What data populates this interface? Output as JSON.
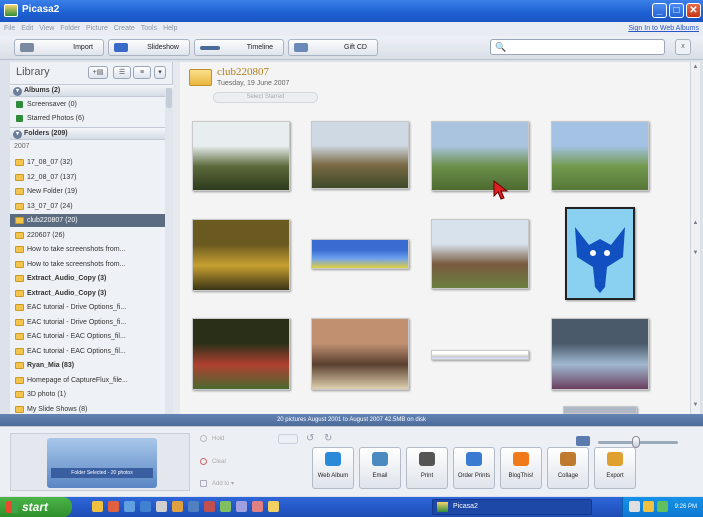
{
  "window": {
    "title": "Picasa2"
  },
  "menu": {
    "items": [
      "File",
      "Edit",
      "View",
      "Folder",
      "Picture",
      "Create",
      "Tools",
      "Help"
    ],
    "sign_in": "Sign In to Web Albums"
  },
  "toolbar": {
    "import": "Import",
    "slideshow": "Slideshow",
    "timeline": "Timeline",
    "gift_cd": "Gift CD"
  },
  "search": {
    "placeholder": "",
    "clear_label": "x"
  },
  "library": {
    "label": "Library",
    "albums_header": "Albums (2)",
    "albums": [
      "Screensaver (0)",
      "Starred Photos (6)"
    ],
    "folders_header": "Folders (209)",
    "year": "2007",
    "folders": [
      {
        "label": "17_08_07 (32)",
        "bold": false,
        "selected": false
      },
      {
        "label": "12_08_07 (137)",
        "bold": false,
        "selected": false
      },
      {
        "label": "New Folder (19)",
        "bold": false,
        "selected": false
      },
      {
        "label": "13_07_07 (24)",
        "bold": false,
        "selected": false
      },
      {
        "label": "club220807 (20)",
        "bold": false,
        "selected": true
      },
      {
        "label": "220607 (26)",
        "bold": false,
        "selected": false
      },
      {
        "label": "How to take screenshots from...",
        "bold": false,
        "selected": false
      },
      {
        "label": "How to take screenshots from...",
        "bold": false,
        "selected": false
      },
      {
        "label": "Extract_Audio_Copy (3)",
        "bold": true,
        "selected": false
      },
      {
        "label": "Extract_Audio_Copy (3)",
        "bold": true,
        "selected": false
      },
      {
        "label": "EAC tutorial - Drive Options_fi...",
        "bold": false,
        "selected": false
      },
      {
        "label": "EAC tutorial - Drive Options_fi...",
        "bold": false,
        "selected": false
      },
      {
        "label": "EAC tutorial - EAC Options_fil...",
        "bold": false,
        "selected": false
      },
      {
        "label": "EAC tutorial - EAC Options_fil...",
        "bold": false,
        "selected": false
      },
      {
        "label": "Ryan_Mia (83)",
        "bold": true,
        "selected": false
      },
      {
        "label": "Homepage of CaptureFlux_file...",
        "bold": false,
        "selected": false
      },
      {
        "label": "3D photo (1)",
        "bold": false,
        "selected": false
      },
      {
        "label": "My Slide Shows (8)",
        "bold": false,
        "selected": false
      }
    ]
  },
  "folder": {
    "name": "club220807",
    "date": "Tuesday, 19 June 2007",
    "select_starred": "Select Starred"
  },
  "photos": [
    {
      "name": "photo-trees-sky",
      "colors": [
        "#e8eef0",
        "#5d6a3c",
        "#2d3a1c"
      ]
    },
    {
      "name": "photo-track-bush",
      "colors": [
        "#cfd9e4",
        "#7a6a45",
        "#3f4a2a"
      ]
    },
    {
      "name": "photo-man-field",
      "colors": [
        "#aac4e0",
        "#6b8f4a",
        "#4d6b30"
      ]
    },
    {
      "name": "photo-two-men-field",
      "colors": [
        "#a3c2e4",
        "#739a4e",
        "#557738"
      ]
    },
    {
      "name": "photo-yellow-flowers",
      "colors": [
        "#6a5a20",
        "#c7a030",
        "#3a3415"
      ]
    },
    {
      "name": "photo-cartoon-banner",
      "colors": [
        "#3a6bd0",
        "#6aa0f0",
        "#e0d040"
      ]
    },
    {
      "name": "photo-house-trees",
      "colors": [
        "#d8e2ec",
        "#7a5a40",
        "#6a8040"
      ]
    },
    {
      "name": "photo-blue-fox-logo",
      "colors": [
        "#ffffff",
        "#8ad0f0",
        "#1050c0"
      ]
    },
    {
      "name": "photo-red-plant",
      "colors": [
        "#2a3018",
        "#b04030",
        "#4a6a30"
      ]
    },
    {
      "name": "photo-crowd-room",
      "colors": [
        "#c09070",
        "#5a4030",
        "#e0d0b0"
      ]
    },
    {
      "name": "photo-thin-strip",
      "colors": [
        "#ffffff",
        "#cccccc",
        "#ddddff"
      ]
    },
    {
      "name": "photo-computer-monitor",
      "colors": [
        "#4a5a6a",
        "#a0b8d0",
        "#6a4060"
      ]
    }
  ],
  "status": "20 pictures   August 2001 to August 2007   42.5MB on disk",
  "tray": {
    "label": "Folder Selected - 20 photos",
    "hold": "Hold",
    "clear": "Clear",
    "add_to": "Add to"
  },
  "actions": [
    {
      "label": "Web Album",
      "color": "#2a8ad8"
    },
    {
      "label": "Email",
      "color": "#4a8ac0"
    },
    {
      "label": "Print",
      "color": "#555555"
    },
    {
      "label": "Order Prints",
      "color": "#3a7ad0"
    },
    {
      "label": "BlogThis!",
      "color": "#f07a1a"
    },
    {
      "label": "Collage",
      "color": "#c07a30"
    },
    {
      "label": "Export",
      "color": "#e0a030"
    }
  ],
  "taskbar": {
    "start": "start",
    "app": "Picasa2",
    "clock": "9:26 PM"
  }
}
